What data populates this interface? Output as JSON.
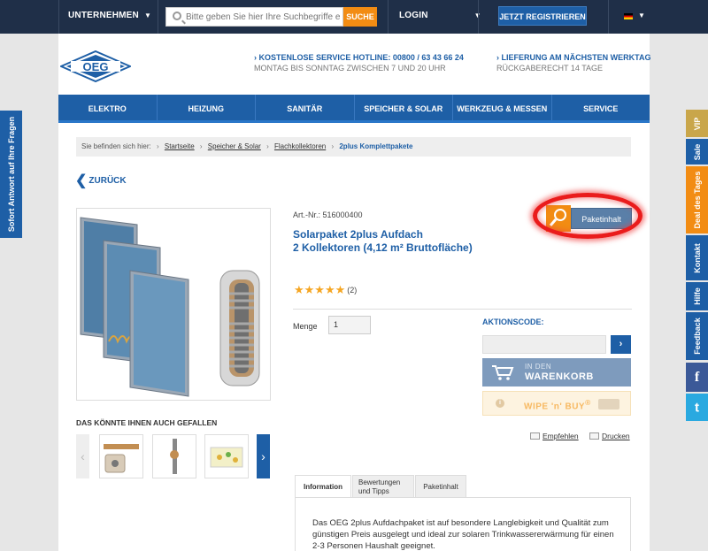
{
  "topbar": {
    "company_menu": "UNTERNEHMEN",
    "search_placeholder": "Bitte geben Sie hier Ihre Suchbegriffe ein",
    "search_button": "SUCHE",
    "login": "LOGIN",
    "register": "JETZT REGISTRIEREN"
  },
  "header": {
    "logo_text": "OEG",
    "hotline_title": "› KOSTENLOSE SERVICE HOTLINE: 00800 / 63 43 66 24",
    "hotline_sub": "MONTAG BIS SONNTAG ZWISCHEN 7 UND 20 UHR",
    "delivery_title": "› LIEFERUNG AM NÄCHSTEN WERKTAG",
    "delivery_sub": "RÜCKGABERECHT 14 TAGE"
  },
  "nav": [
    "ELEKTRO",
    "HEIZUNG",
    "SANITÄR",
    "SPEICHER & SOLAR",
    "WERKZEUG & MESSEN",
    "SERVICE"
  ],
  "breadcrumb": {
    "prefix": "Sie befinden sich hier:",
    "items": [
      "Startseite",
      "Speicher & Solar",
      "Flachkollektoren"
    ],
    "current": "2plus Komplettpakete"
  },
  "back_label": "ZURÜCK",
  "product": {
    "art_nr": "Art.-Nr.: 516000400",
    "title_line1": "Solarpaket 2plus Aufdach",
    "title_line2": "2 Kollektoren (4,12 m² Bruttofläche)",
    "stars": "★★★★★",
    "rating": 5,
    "review_count": "(2)",
    "paket_label": "Paketinhalt",
    "menge_label": "Menge",
    "menge_value": "1"
  },
  "aktion": {
    "label": "AKTIONSCODE:",
    "button": "›"
  },
  "cart": {
    "line1": "IN DEN",
    "line2": "WARENKORB"
  },
  "wipe": {
    "label": "WIPE 'n' BUY",
    "sup": "®",
    "info": "i"
  },
  "actions": {
    "empfehlen": "Empfehlen",
    "drucken": "Drucken"
  },
  "also_like": "DAS KÖNNTE IHNEN AUCH GEFALLEN",
  "carousel": {
    "prev": "‹",
    "next": "›"
  },
  "tabs": [
    {
      "line1": "Information",
      "line2": ""
    },
    {
      "line1": "Bewertungen",
      "line2": "und Tipps"
    },
    {
      "line1": "Paketinhalt",
      "line2": ""
    }
  ],
  "description": "Das OEG 2plus Aufdachpaket ist auf besondere Langlebigkeit und Qualität zum günstigen Preis ausgelegt und ideal zur solaren Trinkwassererwärmung für einen 2-3 Personen Haushalt geeignet.",
  "left_tab": "Sofort Antwort auf Ihre Fragen",
  "right_tabs": [
    "VIP",
    "Sale",
    "Deal des Tages",
    "Kontakt",
    "Hilfe",
    "Feedback",
    "f",
    "t"
  ],
  "colors": {
    "brand_blue": "#1e5fa6",
    "orange": "#f28c13",
    "dark_bar": "#1f2f48"
  }
}
